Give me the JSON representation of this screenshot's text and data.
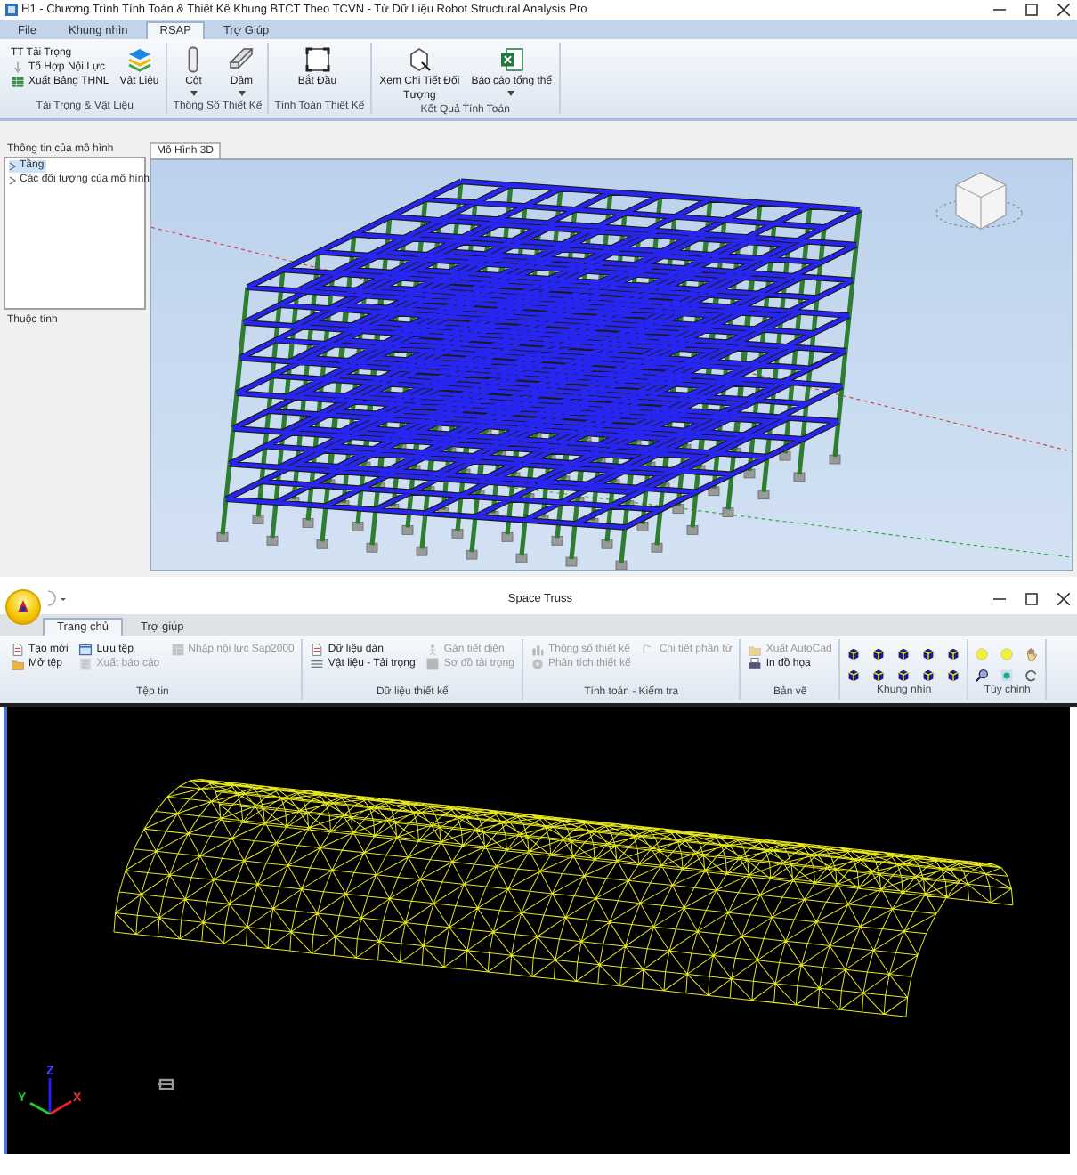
{
  "rsap_window": {
    "title": "H1 - Chương Trình Tính Toán & Thiết Kế Khung BTCT Theo TCVN - Từ Dữ Liệu  Robot Structural  Analysis Pro",
    "tabs": [
      {
        "label": "File",
        "selected": false
      },
      {
        "label": "Khung nhìn",
        "selected": false
      },
      {
        "label": "RSAP",
        "selected": true
      },
      {
        "label": "Trợ Giúp",
        "selected": false
      }
    ],
    "ribbon": [
      {
        "label": "Tải Trọng & Vật Liệu",
        "kind": "buttons",
        "items": [
          {
            "label": "TT Tải Trọng",
            "kind": "small",
            "disabled": false
          },
          {
            "label": "Tổ Hợp Nội Lực",
            "kind": "small",
            "disabled": false
          },
          {
            "label": "Xuất Bảng THNL",
            "kind": "small",
            "disabled": false
          },
          {
            "label": "Vật Liệu",
            "kind": "large",
            "disabled": false,
            "dropdown": false
          }
        ]
      },
      {
        "label": "Thông Số Thiết Kế",
        "kind": "buttons",
        "items": [
          {
            "label": "Cột",
            "kind": "large",
            "disabled": false,
            "dropdown": true
          },
          {
            "label": "Dầm",
            "kind": "large",
            "disabled": false,
            "dropdown": true
          }
        ]
      },
      {
        "label": "Tính Toán Thiết Kế",
        "kind": "buttons",
        "items": [
          {
            "label": "Bắt Đầu",
            "kind": "large",
            "disabled": false,
            "dropdown": false
          }
        ]
      },
      {
        "label": "Kết Quả Tính Toán",
        "kind": "buttons",
        "items": [
          {
            "label": "Xem Chi Tiết Đối Tượng",
            "kind": "large",
            "disabled": false,
            "dropdown": false
          },
          {
            "label": "Báo cáo tổng thể",
            "kind": "large",
            "disabled": false,
            "dropdown": true
          }
        ]
      }
    ],
    "model_panel": {
      "title": "Thông tin của mô hình",
      "tree": [
        {
          "label": "Tầng",
          "selected": true,
          "expanded": false
        },
        {
          "label": "Các đối tượng của mô hình",
          "selected": false,
          "expanded": false
        }
      ],
      "properties_title": "Thuộc tính"
    },
    "document_tab": "Mô Hình 3D"
  },
  "space_truss_window": {
    "title": "Space Truss",
    "tabs": [
      {
        "label": "Trang chủ",
        "selected": true
      },
      {
        "label": "Trợ giúp",
        "selected": false
      }
    ],
    "ribbon": [
      {
        "label": "Tệp tin",
        "kind": "buttons",
        "items": [
          {
            "label": "Tạo mới",
            "kind": "small",
            "disabled": false
          },
          {
            "label": "Mở tệp",
            "kind": "small",
            "disabled": false
          },
          {
            "label": "Lưu tệp",
            "kind": "small",
            "disabled": false
          },
          {
            "label": "Xuất  báo cáo",
            "kind": "small",
            "disabled": true
          },
          {
            "label": "Nhập nội lực Sap2000",
            "kind": "small",
            "disabled": true
          }
        ]
      },
      {
        "label": "Dữ liệu thiết kế",
        "kind": "buttons",
        "items": [
          {
            "label": "Dữ liệu dàn",
            "kind": "small",
            "disabled": false
          },
          {
            "label": "Vật liệu - Tải trọng",
            "kind": "small",
            "disabled": false
          },
          {
            "label": "Gán tiết diện",
            "kind": "small",
            "disabled": true
          },
          {
            "label": "Sơ đồ tải trọng",
            "kind": "small",
            "disabled": true
          }
        ]
      },
      {
        "label": "Tính toán - Kiểm tra",
        "kind": "buttons",
        "items": [
          {
            "label": "Thông số thiết kế",
            "kind": "small",
            "disabled": true
          },
          {
            "label": "Phân tích thiết kế",
            "kind": "small",
            "disabled": true
          },
          {
            "label": "Chi tiết phần tử",
            "kind": "small",
            "disabled": true
          }
        ]
      },
      {
        "label": "Bản vẽ",
        "kind": "buttons",
        "items": [
          {
            "label": "Xuất AutoCad",
            "kind": "small",
            "disabled": true
          },
          {
            "label": "In đồ họa",
            "kind": "small",
            "disabled": false
          }
        ]
      },
      {
        "label": "Khung nhìn",
        "kind": "icons"
      },
      {
        "label": "Tùy chỉnh",
        "kind": "icons"
      }
    ],
    "axes": {
      "x": "X",
      "y": "Y",
      "z": "Z"
    }
  }
}
